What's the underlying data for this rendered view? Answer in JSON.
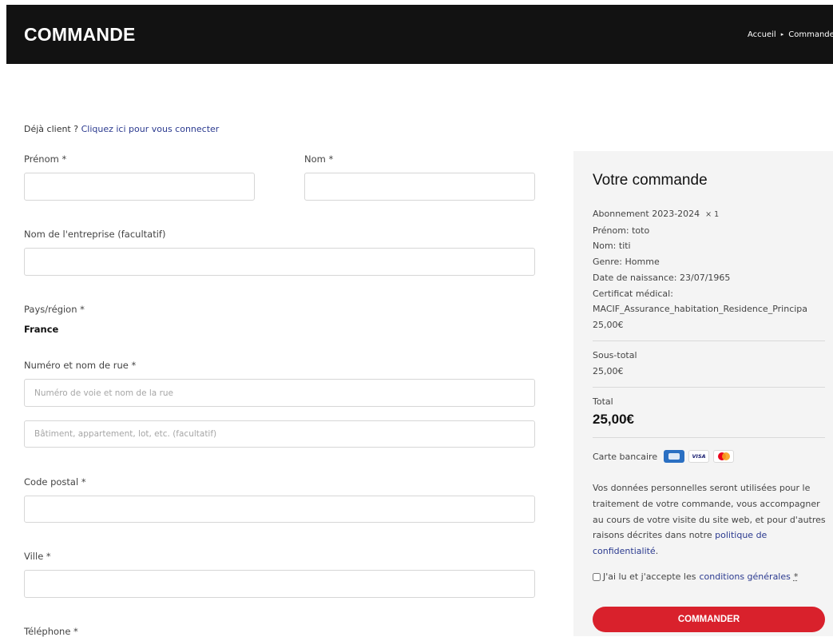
{
  "header": {
    "title": "COMMANDE",
    "breadcrumb": [
      "Accueil",
      "Commande"
    ]
  },
  "login": {
    "prompt": "Déjà client ?",
    "link": "Cliquez ici pour vous connecter"
  },
  "billing": {
    "first_name_label": "Prénom *",
    "last_name_label": "Nom *",
    "company_label": "Nom de l'entreprise (facultatif)",
    "country_label": "Pays/région *",
    "country_value": "France",
    "street_label": "Numéro et nom de rue *",
    "street_placeholder": "Numéro de voie et nom de la rue",
    "street2_placeholder": "Bâtiment, appartement, lot, etc. (facultatif)",
    "postcode_label": "Code postal *",
    "city_label": "Ville *",
    "phone_label": "Téléphone *"
  },
  "order": {
    "title": "Votre commande",
    "item_name": "Abonnement 2023-2024",
    "item_qty": "× 1",
    "item_details": [
      "Prénom: toto",
      "Nom: titi",
      "Genre: Homme",
      "Date de naissance: 23/07/1965",
      "Certificat médical:",
      "MACIF_Assurance_habitation_Residence_Principa"
    ],
    "item_price": "25,00€",
    "subtotal_label": "Sous-total",
    "subtotal_value": "25,00€",
    "total_label": "Total",
    "total_value": "25,00€",
    "payment_label": "Carte bancaire",
    "card_visa": "VISA",
    "privacy_text": "Vos données personnelles seront utilisées pour le traitement de votre commande, vous accompagner au cours de votre visite du site web, et pour d'autres raisons décrites dans notre",
    "privacy_link": "politique de confidentialité",
    "privacy_end": ".",
    "terms_text": "J'ai lu et j'accepte les",
    "terms_link": "conditions générales",
    "terms_required": "*",
    "submit_label": "COMMANDER"
  },
  "colors": {
    "header_bg": "#121212",
    "accent_button": "#d9212c",
    "link": "#2b3a8f",
    "sidebar_bg": "#f4f4f4"
  }
}
